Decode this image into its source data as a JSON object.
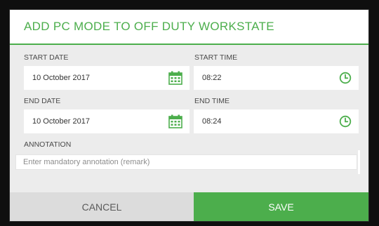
{
  "dialog": {
    "title": "ADD PC MODE TO OFF DUTY WORKSTATE",
    "start_date": {
      "label": "START DATE",
      "value": "10 October 2017",
      "icon": "calendar-icon"
    },
    "start_time": {
      "label": "START TIME",
      "value": "08:22",
      "icon": "clock-icon"
    },
    "end_date": {
      "label": "END DATE",
      "value": "10 October 2017",
      "icon": "calendar-icon"
    },
    "end_time": {
      "label": "END TIME",
      "value": "08:24",
      "icon": "clock-icon"
    },
    "annotation": {
      "label": "ANNOTATION",
      "placeholder": "Enter mandatory annotation (remark)",
      "value": ""
    },
    "cancel_label": "CANCEL",
    "save_label": "SAVE"
  },
  "colors": {
    "accent": "#4cae4c",
    "dialog_background": "#ececec",
    "cancel_background": "#dcdcdc"
  }
}
